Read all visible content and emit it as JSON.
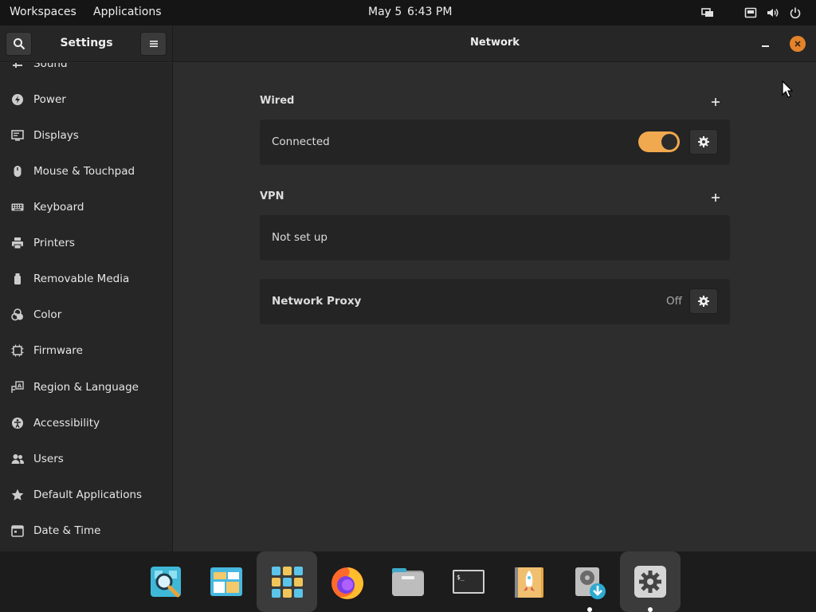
{
  "topbar": {
    "workspaces": "Workspaces",
    "applications": "Applications",
    "date": "May 5",
    "time": "6:43 PM",
    "status_icons": [
      "multitask-view-icon",
      "network-wired-icon",
      "volume-icon",
      "power-icon"
    ]
  },
  "window": {
    "sidebar_title": "Settings",
    "page_title": "Network"
  },
  "sidebar": {
    "items": [
      {
        "label": "Sound",
        "icon": "sound-icon"
      },
      {
        "label": "Power",
        "icon": "power-bolt-icon"
      },
      {
        "label": "Displays",
        "icon": "display-icon"
      },
      {
        "label": "Mouse & Touchpad",
        "icon": "mouse-icon"
      },
      {
        "label": "Keyboard",
        "icon": "keyboard-icon"
      },
      {
        "label": "Printers",
        "icon": "printer-icon"
      },
      {
        "label": "Removable Media",
        "icon": "usb-drive-icon"
      },
      {
        "label": "Color",
        "icon": "color-icon"
      },
      {
        "label": "Firmware",
        "icon": "chip-icon"
      },
      {
        "label": "Region & Language",
        "icon": "language-icon"
      },
      {
        "label": "Accessibility",
        "icon": "accessibility-icon"
      },
      {
        "label": "Users",
        "icon": "users-icon"
      },
      {
        "label": "Default Applications",
        "icon": "star-icon"
      },
      {
        "label": "Date & Time",
        "icon": "clock-icon"
      }
    ]
  },
  "network": {
    "wired": {
      "title": "Wired",
      "status": "Connected",
      "enabled": true
    },
    "vpn": {
      "title": "VPN",
      "status": "Not set up"
    },
    "proxy": {
      "title": "Network Proxy",
      "status": "Off"
    }
  },
  "dock": {
    "items": [
      {
        "name": "search-app",
        "running": false
      },
      {
        "name": "app-center",
        "running": false
      },
      {
        "name": "app-grid",
        "running": false
      },
      {
        "name": "firefox",
        "running": false
      },
      {
        "name": "files",
        "running": false
      },
      {
        "name": "terminal",
        "running": false
      },
      {
        "name": "rocket-app",
        "running": false
      },
      {
        "name": "disk-utility",
        "running": true
      },
      {
        "name": "settings",
        "running": true
      }
    ]
  },
  "colors": {
    "accent": "#f0a94e",
    "close_button": "#e5832a"
  }
}
